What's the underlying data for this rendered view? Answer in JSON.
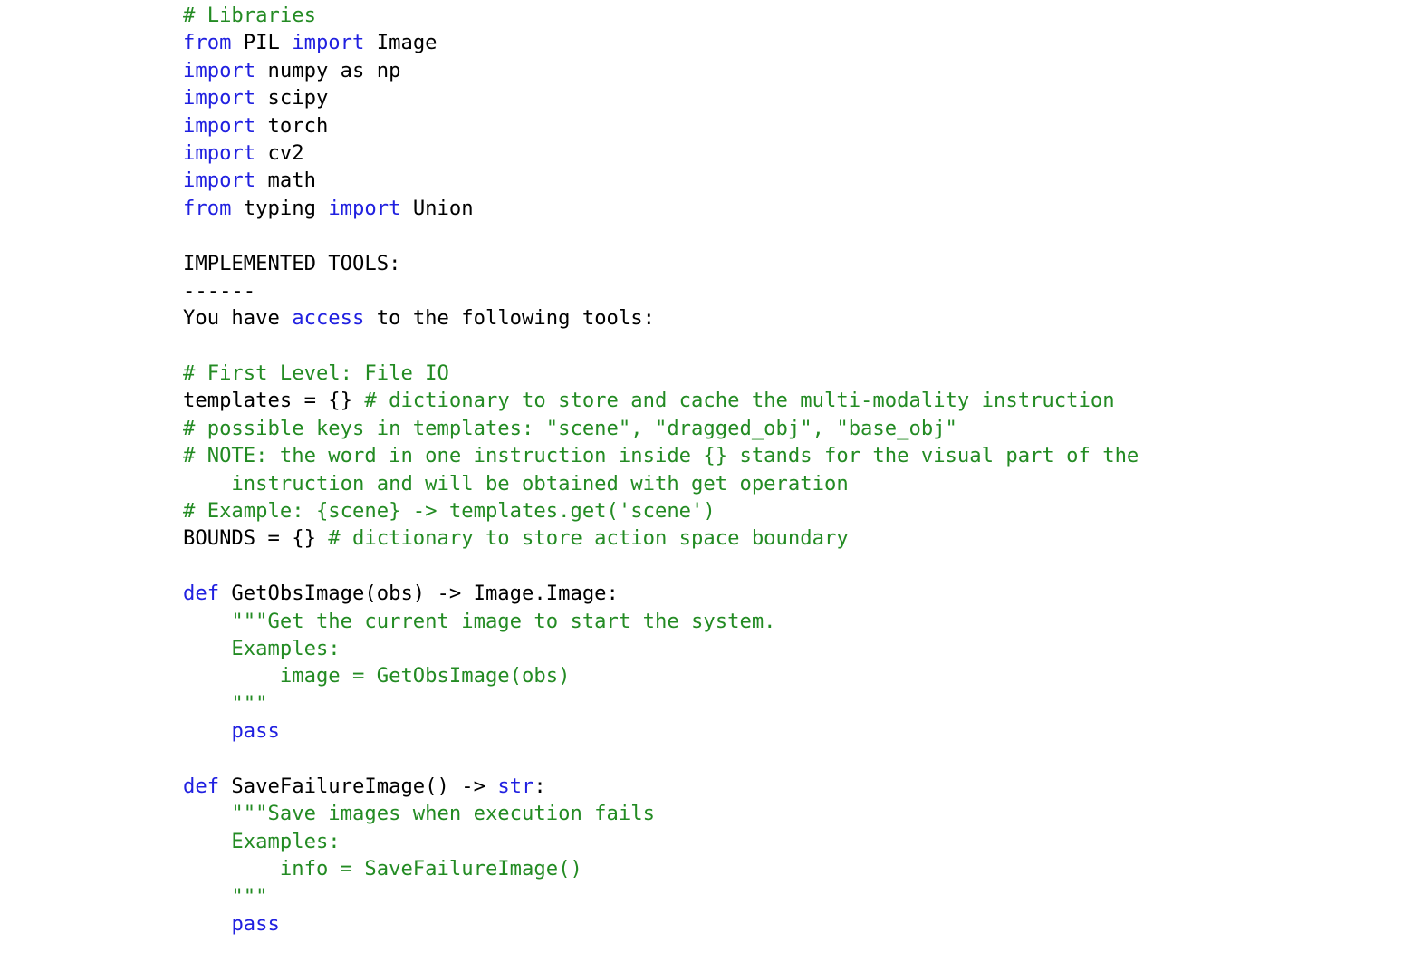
{
  "document": {
    "kind": "python-source-listing",
    "background_color": "#ffffff",
    "colors": {
      "comment_green": "#238b23",
      "keyword_blue": "#2020e0",
      "plain_black": "#000000"
    }
  },
  "code": {
    "lines": [
      {
        "id": "l01",
        "indent": 0,
        "tokens": [
          {
            "t": "# Libraries",
            "c": "cm"
          }
        ]
      },
      {
        "id": "l02",
        "indent": 0,
        "tokens": [
          {
            "t": "from",
            "c": "kw"
          },
          {
            "t": " PIL ",
            "c": "tx"
          },
          {
            "t": "import",
            "c": "kw"
          },
          {
            "t": " Image",
            "c": "tx"
          }
        ]
      },
      {
        "id": "l03",
        "indent": 0,
        "tokens": [
          {
            "t": "import",
            "c": "kw"
          },
          {
            "t": " numpy as np",
            "c": "tx"
          }
        ]
      },
      {
        "id": "l04",
        "indent": 0,
        "tokens": [
          {
            "t": "import",
            "c": "kw"
          },
          {
            "t": " scipy",
            "c": "tx"
          }
        ]
      },
      {
        "id": "l05",
        "indent": 0,
        "tokens": [
          {
            "t": "import",
            "c": "kw"
          },
          {
            "t": " torch",
            "c": "tx"
          }
        ]
      },
      {
        "id": "l06",
        "indent": 0,
        "tokens": [
          {
            "t": "import",
            "c": "kw"
          },
          {
            "t": " cv2",
            "c": "tx"
          }
        ]
      },
      {
        "id": "l07",
        "indent": 0,
        "tokens": [
          {
            "t": "import",
            "c": "kw"
          },
          {
            "t": " math",
            "c": "tx"
          }
        ]
      },
      {
        "id": "l08",
        "indent": 0,
        "tokens": [
          {
            "t": "from",
            "c": "kw"
          },
          {
            "t": " typing ",
            "c": "tx"
          },
          {
            "t": "import",
            "c": "kw"
          },
          {
            "t": " Union",
            "c": "tx"
          }
        ]
      },
      {
        "id": "l09",
        "indent": 0,
        "tokens": []
      },
      {
        "id": "l10",
        "indent": 0,
        "tokens": [
          {
            "t": "IMPLEMENTED TOOLS:",
            "c": "tx"
          }
        ]
      },
      {
        "id": "l11",
        "indent": 0,
        "tokens": [
          {
            "t": "------",
            "c": "tx"
          }
        ]
      },
      {
        "id": "l12",
        "indent": 0,
        "tokens": [
          {
            "t": "You have ",
            "c": "tx"
          },
          {
            "t": "access",
            "c": "kw"
          },
          {
            "t": " to the following tools:",
            "c": "tx"
          }
        ]
      },
      {
        "id": "l13",
        "indent": 0,
        "tokens": []
      },
      {
        "id": "l14",
        "indent": 0,
        "tokens": [
          {
            "t": "# First Level: File IO",
            "c": "cm"
          }
        ]
      },
      {
        "id": "l15",
        "indent": 0,
        "tokens": [
          {
            "t": "templates = {} ",
            "c": "tx"
          },
          {
            "t": "# dictionary to store and cache the multi-modality instruction",
            "c": "cm"
          }
        ]
      },
      {
        "id": "l16",
        "indent": 0,
        "tokens": [
          {
            "t": "# possible keys in templates: \"scene\", \"dragged_obj\", \"base_obj\"",
            "c": "cm"
          }
        ]
      },
      {
        "id": "l17",
        "indent": 0,
        "tokens": [
          {
            "t": "# NOTE: the word in one instruction inside {} stands for the visual part of the",
            "c": "cm"
          }
        ]
      },
      {
        "id": "l18",
        "indent": 0,
        "tokens": [
          {
            "t": "    instruction and will be obtained with get operation",
            "c": "cm"
          }
        ]
      },
      {
        "id": "l19",
        "indent": 0,
        "tokens": [
          {
            "t": "# Example: {scene} -> templates.get('scene')",
            "c": "cm"
          }
        ]
      },
      {
        "id": "l20",
        "indent": 0,
        "tokens": [
          {
            "t": "BOUNDS = {} ",
            "c": "tx"
          },
          {
            "t": "# dictionary to store action space boundary",
            "c": "cm"
          }
        ]
      },
      {
        "id": "l21",
        "indent": 0,
        "tokens": []
      },
      {
        "id": "l22",
        "indent": 0,
        "tokens": [
          {
            "t": "def",
            "c": "kw"
          },
          {
            "t": " GetObsImage(obs) -> Image.Image:",
            "c": "tx"
          }
        ]
      },
      {
        "id": "l23",
        "indent": 0,
        "tokens": [
          {
            "t": "    \"\"\"Get the current image to start the system.",
            "c": "cm"
          }
        ]
      },
      {
        "id": "l24",
        "indent": 0,
        "tokens": [
          {
            "t": "    Examples:",
            "c": "cm"
          }
        ]
      },
      {
        "id": "l25",
        "indent": 0,
        "tokens": [
          {
            "t": "        image = GetObsImage(obs)",
            "c": "cm"
          }
        ]
      },
      {
        "id": "l26",
        "indent": 0,
        "tokens": [
          {
            "t": "    \"\"\"",
            "c": "cm"
          }
        ]
      },
      {
        "id": "l27",
        "indent": 0,
        "tokens": [
          {
            "t": "    ",
            "c": "tx"
          },
          {
            "t": "pass",
            "c": "kw"
          }
        ]
      },
      {
        "id": "l28",
        "indent": 0,
        "tokens": []
      },
      {
        "id": "l29",
        "indent": 0,
        "tokens": [
          {
            "t": "def",
            "c": "kw"
          },
          {
            "t": " SaveFailureImage() -> ",
            "c": "tx"
          },
          {
            "t": "str",
            "c": "kw"
          },
          {
            "t": ":",
            "c": "tx"
          }
        ]
      },
      {
        "id": "l30",
        "indent": 0,
        "tokens": [
          {
            "t": "    \"\"\"Save images when execution fails",
            "c": "cm"
          }
        ]
      },
      {
        "id": "l31",
        "indent": 0,
        "tokens": [
          {
            "t": "    Examples:",
            "c": "cm"
          }
        ]
      },
      {
        "id": "l32",
        "indent": 0,
        "tokens": [
          {
            "t": "        info = SaveFailureImage()",
            "c": "cm"
          }
        ]
      },
      {
        "id": "l33",
        "indent": 0,
        "tokens": [
          {
            "t": "    \"\"\"",
            "c": "cm"
          }
        ]
      },
      {
        "id": "l34",
        "indent": 0,
        "tokens": [
          {
            "t": "    ",
            "c": "tx"
          },
          {
            "t": "pass",
            "c": "kw"
          }
        ]
      }
    ]
  }
}
